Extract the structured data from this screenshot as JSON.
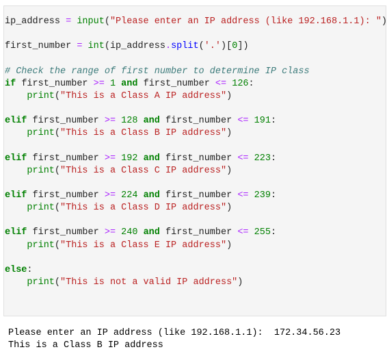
{
  "code": {
    "l1": {
      "var": "ip_address",
      "eq": " = ",
      "fn": "input",
      "open": "(",
      "str": "\"Please enter an IP address (like 192.168.1.1): \"",
      "close": ")"
    },
    "l2": {
      "var": "first_number",
      "eq": " = ",
      "fn": "int",
      "open": "(",
      "arg": "ip_address",
      "dot": ".",
      "method": "split",
      "open2": "(",
      "str": "'.'",
      "close2": ")",
      "idx_open": "[",
      "idx": "0",
      "idx_close": "]",
      "close": ")"
    },
    "comment": "# Check the range of first number to determine IP class",
    "branches": [
      {
        "kw": "if",
        "op1": ">=",
        "lo": "1",
        "op2": "<=",
        "hi": "126",
        "msg": "\"This is a Class A IP address\""
      },
      {
        "kw": "elif",
        "op1": ">=",
        "lo": "128",
        "op2": "<=",
        "hi": "191",
        "msg": "\"This is a Class B IP address\""
      },
      {
        "kw": "elif",
        "op1": ">=",
        "lo": "192",
        "op2": "<=",
        "hi": "223",
        "msg": "\"This is a Class C IP address\""
      },
      {
        "kw": "elif",
        "op1": ">=",
        "lo": "224",
        "op2": "<=",
        "hi": "239",
        "msg": "\"This is a Class D IP address\""
      },
      {
        "kw": "elif",
        "op1": ">=",
        "lo": "240",
        "op2": "<=",
        "hi": "255",
        "msg": "\"This is a Class E IP address\""
      }
    ],
    "var_name": "first_number",
    "and_kw": "and",
    "print_fn": "print",
    "else_kw": "else",
    "else_msg": "\"This is not a valid IP address\""
  },
  "output": {
    "prompt": "Please enter an IP address (like 192.168.1.1):  ",
    "entered_value": "172.34.56.23",
    "result": "This is a Class B IP address"
  }
}
